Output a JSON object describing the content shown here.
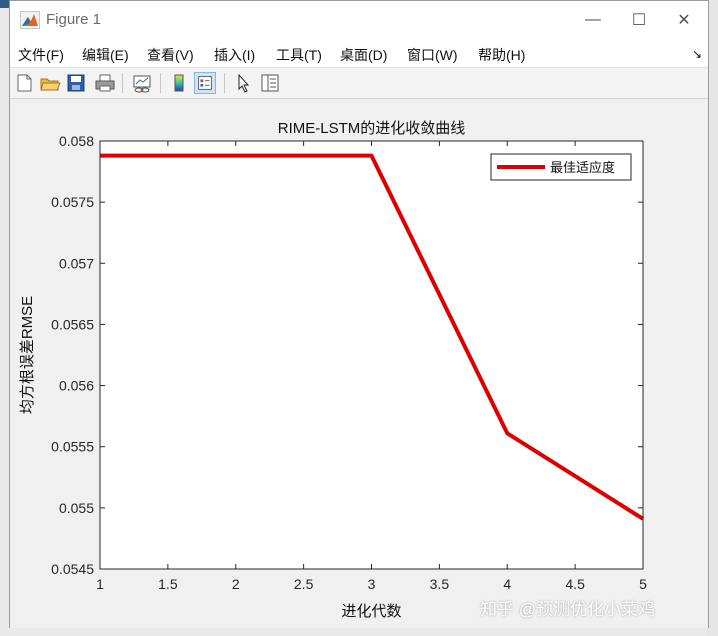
{
  "window": {
    "title": "Figure 1"
  },
  "window_controls": {
    "minimize": "—",
    "maximize": "☐",
    "close": "✕"
  },
  "menu": [
    "文件(F)",
    "编辑(E)",
    "查看(V)",
    "插入(I)",
    "工具(T)",
    "桌面(D)",
    "窗口(W)",
    "帮助(H)"
  ],
  "menu_overflow": "↘",
  "toolbar": [
    "new-figure-icon",
    "open-folder-icon",
    "save-icon",
    "print-icon",
    "link-plot-icon",
    "colorbar-icon",
    "legend-icon",
    "pointer-icon",
    "property-inspector-icon"
  ],
  "watermark": "知乎 @预测优化小菜鸡",
  "chart_data": {
    "type": "line",
    "title": "RIME-LSTM的进化收敛曲线",
    "xlabel": "进化代数",
    "ylabel": "均方根误差RMSE",
    "x": [
      1,
      2,
      3,
      4,
      5
    ],
    "series": [
      {
        "name": "最佳适应度",
        "values": [
          0.05788,
          0.05788,
          0.05788,
          0.05561,
          0.05491
        ],
        "color": "#dd0000"
      }
    ],
    "xlim": [
      1,
      5
    ],
    "ylim": [
      0.0545,
      0.058
    ],
    "xticks": [
      "1",
      "1.5",
      "2",
      "2.5",
      "3",
      "3.5",
      "4",
      "4.5",
      "5"
    ],
    "yticks": [
      "0.0545",
      "0.055",
      "0.0555",
      "0.056",
      "0.0565",
      "0.057",
      "0.0575",
      "0.058"
    ],
    "grid": false,
    "legend": "top-right"
  }
}
